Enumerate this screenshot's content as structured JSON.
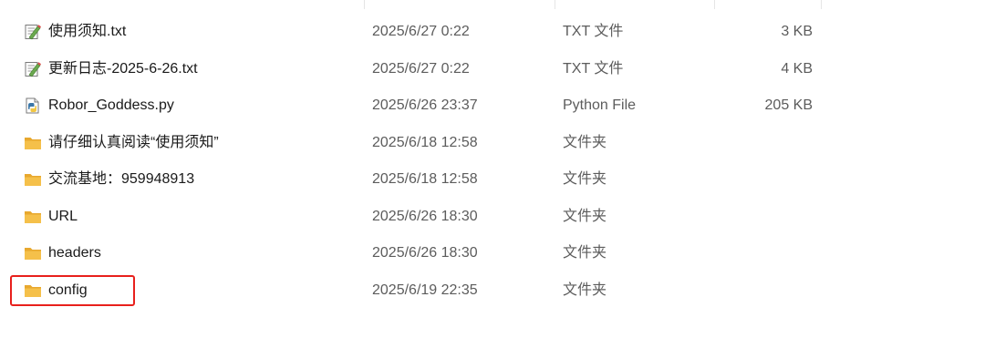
{
  "colors": {
    "highlight": "#e8201c",
    "folder": "#f5c04a",
    "secondary_text": "#5c5c5c"
  },
  "files": [
    {
      "name": "使用须知.txt",
      "date": "2025/6/27 0:22",
      "type": "TXT 文件",
      "size": "3 KB",
      "icon": "text-file-icon"
    },
    {
      "name": "更新日志-2025-6-26.txt",
      "date": "2025/6/27 0:22",
      "type": "TXT 文件",
      "size": "4 KB",
      "icon": "text-file-icon"
    },
    {
      "name": "Robor_Goddess.py",
      "date": "2025/6/26 23:37",
      "type": "Python File",
      "size": "205 KB",
      "icon": "python-file-icon"
    },
    {
      "name": "请仔细认真阅读“使用须知”",
      "date": "2025/6/18 12:58",
      "type": "文件夹",
      "size": "",
      "icon": "folder-icon"
    },
    {
      "name": "交流基地：959948913",
      "date": "2025/6/18 12:58",
      "type": "文件夹",
      "size": "",
      "icon": "folder-icon"
    },
    {
      "name": "URL",
      "date": "2025/6/26 18:30",
      "type": "文件夹",
      "size": "",
      "icon": "folder-icon"
    },
    {
      "name": "headers",
      "date": "2025/6/26 18:30",
      "type": "文件夹",
      "size": "",
      "icon": "folder-icon"
    },
    {
      "name": "config",
      "date": "2025/6/19 22:35",
      "type": "文件夹",
      "size": "",
      "icon": "folder-icon"
    }
  ]
}
